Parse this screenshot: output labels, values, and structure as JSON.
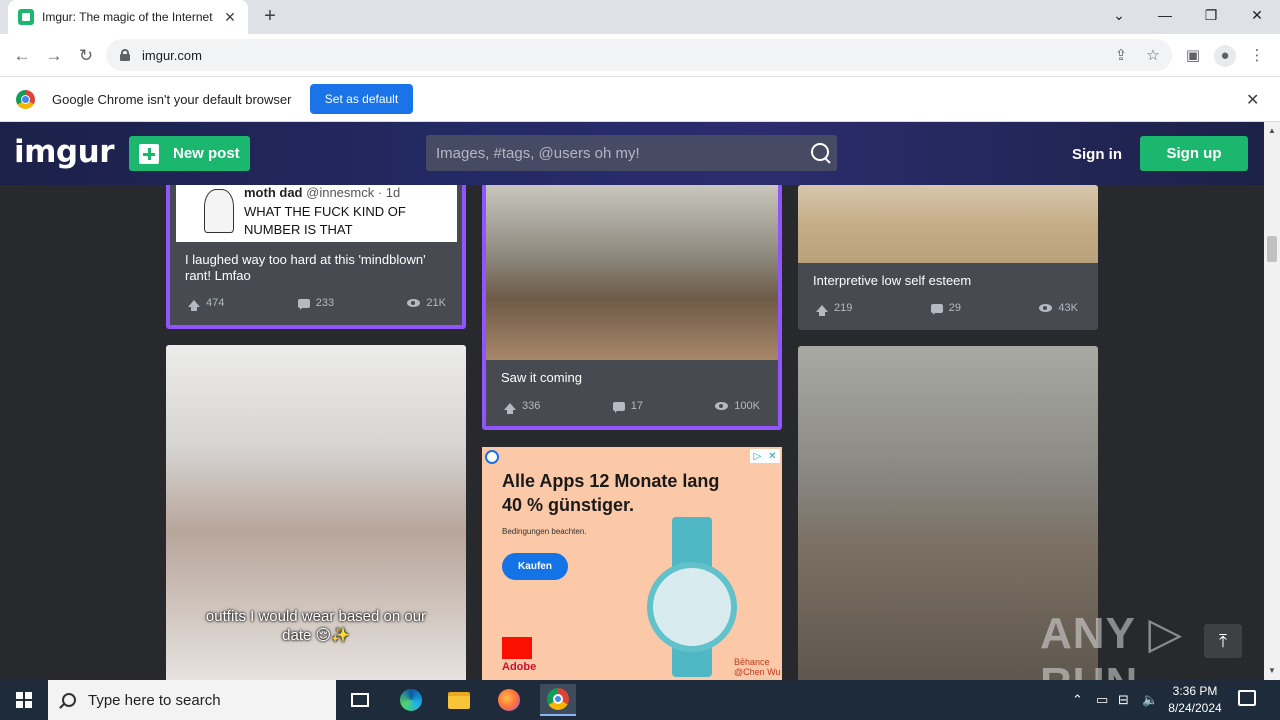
{
  "browser": {
    "tab_title": "Imgur: The magic of the Internet",
    "url": "imgur.com",
    "infobar_text": "Google Chrome isn't your default browser",
    "infobar_button": "Set as default"
  },
  "header": {
    "logo": "imgur",
    "new_post": "New post",
    "search_placeholder": "Images, #tags, @users oh my!",
    "sign_in": "Sign in",
    "sign_up": "Sign up"
  },
  "posts": [
    {
      "title": "I laughed way too hard at this 'mindblown' rant! Lmfao",
      "tweet_name": "moth dad",
      "tweet_handle": "@innesmck · 1d",
      "tweet_text": "WHAT THE FUCK KIND OF NUMBER IS THAT",
      "upvotes": "474",
      "comments": "233",
      "views": "21K"
    },
    {
      "title": "Saw it coming",
      "upvotes": "336",
      "comments": "17",
      "views": "100K"
    },
    {
      "title": "Interpretive low self esteem",
      "upvotes": "219",
      "comments": "29",
      "views": "43K"
    },
    {
      "overlay": "outfits I would wear based on our date 😌✨"
    }
  ],
  "ad": {
    "headline_1": "Alle Apps 12 Monate lang",
    "headline_2": "40 % günstiger.",
    "small": "Bedingungen beachten.",
    "button": "Kaufen",
    "brand": "Adobe",
    "credit_1": "Bēhance",
    "credit_2": "@Chen Wu"
  },
  "watermark": "ANY ▷ RUN",
  "taskbar": {
    "search_placeholder": "Type here to search",
    "time": "3:36 PM",
    "date": "8/24/2024"
  },
  "colors": {
    "imgur_green": "#1bb76e",
    "active_border": "#9055ff",
    "card_bg": "#474a51",
    "page_bg": "#27292d"
  }
}
